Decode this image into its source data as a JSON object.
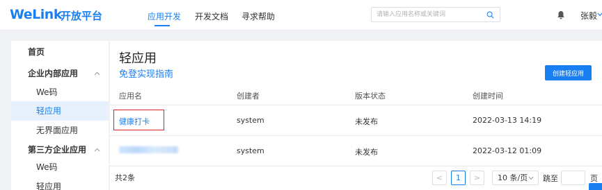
{
  "header": {
    "logo": "WeLink",
    "logo_sub": "开放平台",
    "nav": [
      {
        "label": "应用开发",
        "active": true
      },
      {
        "label": "开发文档",
        "active": false
      },
      {
        "label": "寻求帮助",
        "active": false
      }
    ],
    "search_placeholder": "请输入应用名称或关键词",
    "search_icon": "search-icon",
    "bell_icon": "bell-icon",
    "username": "张毅"
  },
  "sidebar": {
    "items": [
      {
        "label": "首页",
        "type": "top"
      },
      {
        "label": "企业内部应用",
        "type": "group"
      },
      {
        "label": "We码",
        "type": "sub"
      },
      {
        "label": "轻应用",
        "type": "sub",
        "selected": true
      },
      {
        "label": "无界面应用",
        "type": "sub"
      },
      {
        "label": "第三方企业应用",
        "type": "group"
      },
      {
        "label": "We码",
        "type": "sub"
      },
      {
        "label": "轻应用",
        "type": "sub"
      }
    ]
  },
  "main": {
    "title": "轻应用",
    "guide_link": "免登实现指南",
    "create_button": "创建轻应用",
    "table": {
      "columns": [
        "应用名",
        "创建者",
        "版本状态",
        "创建时间"
      ],
      "rows": [
        {
          "name": "健康打卡",
          "creator": "system",
          "status": "未发布",
          "created": "2022-03-13 14:19"
        },
        {
          "name": "",
          "creator": "system",
          "status": "未发布",
          "created": "2022-03-12 01:09"
        }
      ]
    },
    "pagination": {
      "total": "共2条",
      "prev": "<",
      "current_page": "1",
      "next": ">",
      "page_size": "10 条/页",
      "jump_label": "跳至",
      "page_unit": "页"
    }
  },
  "colors": {
    "accent": "#1a7ff0",
    "highlight_box": "#e02020",
    "selected_bg": "#e6f1fd"
  }
}
